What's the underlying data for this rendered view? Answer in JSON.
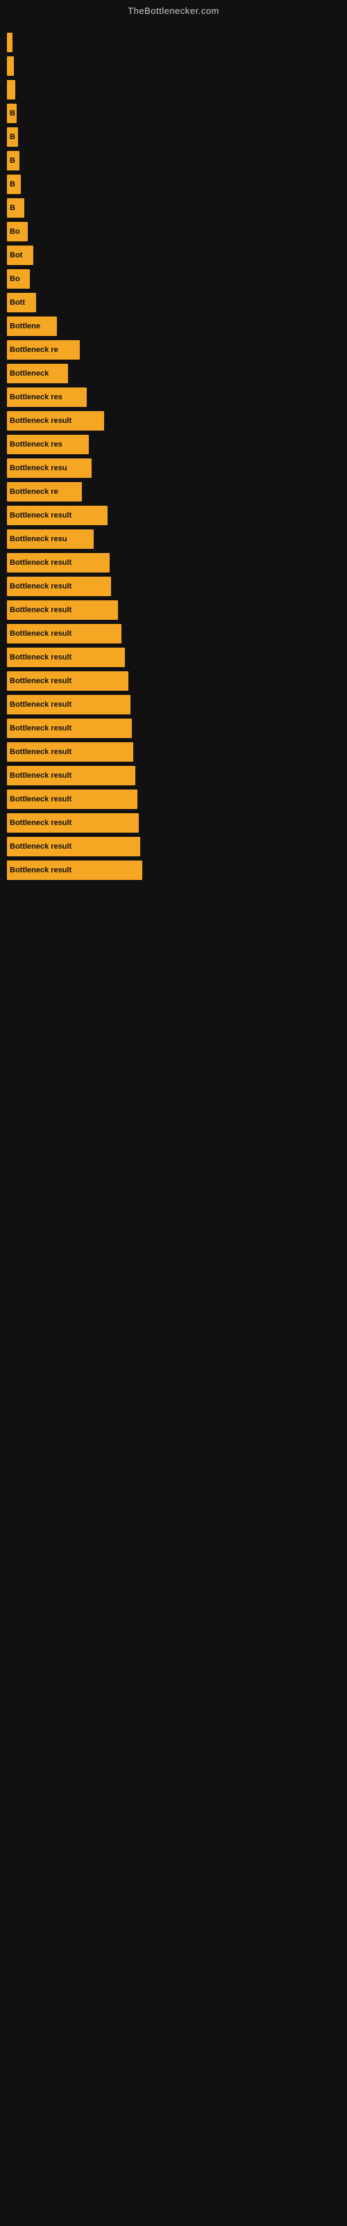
{
  "site_title": "TheBottlenecker.com",
  "bars": [
    {
      "label": "",
      "width": 8
    },
    {
      "label": "",
      "width": 10
    },
    {
      "label": "",
      "width": 12
    },
    {
      "label": "B",
      "width": 14
    },
    {
      "label": "B",
      "width": 16
    },
    {
      "label": "B",
      "width": 18
    },
    {
      "label": "B",
      "width": 20
    },
    {
      "label": "B",
      "width": 25
    },
    {
      "label": "Bo",
      "width": 30
    },
    {
      "label": "Bot",
      "width": 38
    },
    {
      "label": "Bo",
      "width": 33
    },
    {
      "label": "Bott",
      "width": 42
    },
    {
      "label": "Bottlene",
      "width": 72
    },
    {
      "label": "Bottleneck re",
      "width": 105
    },
    {
      "label": "Bottleneck",
      "width": 88
    },
    {
      "label": "Bottleneck res",
      "width": 115
    },
    {
      "label": "Bottleneck result",
      "width": 140
    },
    {
      "label": "Bottleneck res",
      "width": 118
    },
    {
      "label": "Bottleneck resu",
      "width": 122
    },
    {
      "label": "Bottleneck re",
      "width": 108
    },
    {
      "label": "Bottleneck result",
      "width": 145
    },
    {
      "label": "Bottleneck resu",
      "width": 125
    },
    {
      "label": "Bottleneck result",
      "width": 148
    },
    {
      "label": "Bottleneck result",
      "width": 150
    },
    {
      "label": "Bottleneck result",
      "width": 160
    },
    {
      "label": "Bottleneck result",
      "width": 165
    },
    {
      "label": "Bottleneck result",
      "width": 170
    },
    {
      "label": "Bottleneck result",
      "width": 175
    },
    {
      "label": "Bottleneck result",
      "width": 178
    },
    {
      "label": "Bottleneck result",
      "width": 180
    },
    {
      "label": "Bottleneck result",
      "width": 182
    },
    {
      "label": "Bottleneck result",
      "width": 185
    },
    {
      "label": "Bottleneck result",
      "width": 188
    },
    {
      "label": "Bottleneck result",
      "width": 190
    },
    {
      "label": "Bottleneck result",
      "width": 192
    },
    {
      "label": "Bottleneck result",
      "width": 195
    }
  ]
}
